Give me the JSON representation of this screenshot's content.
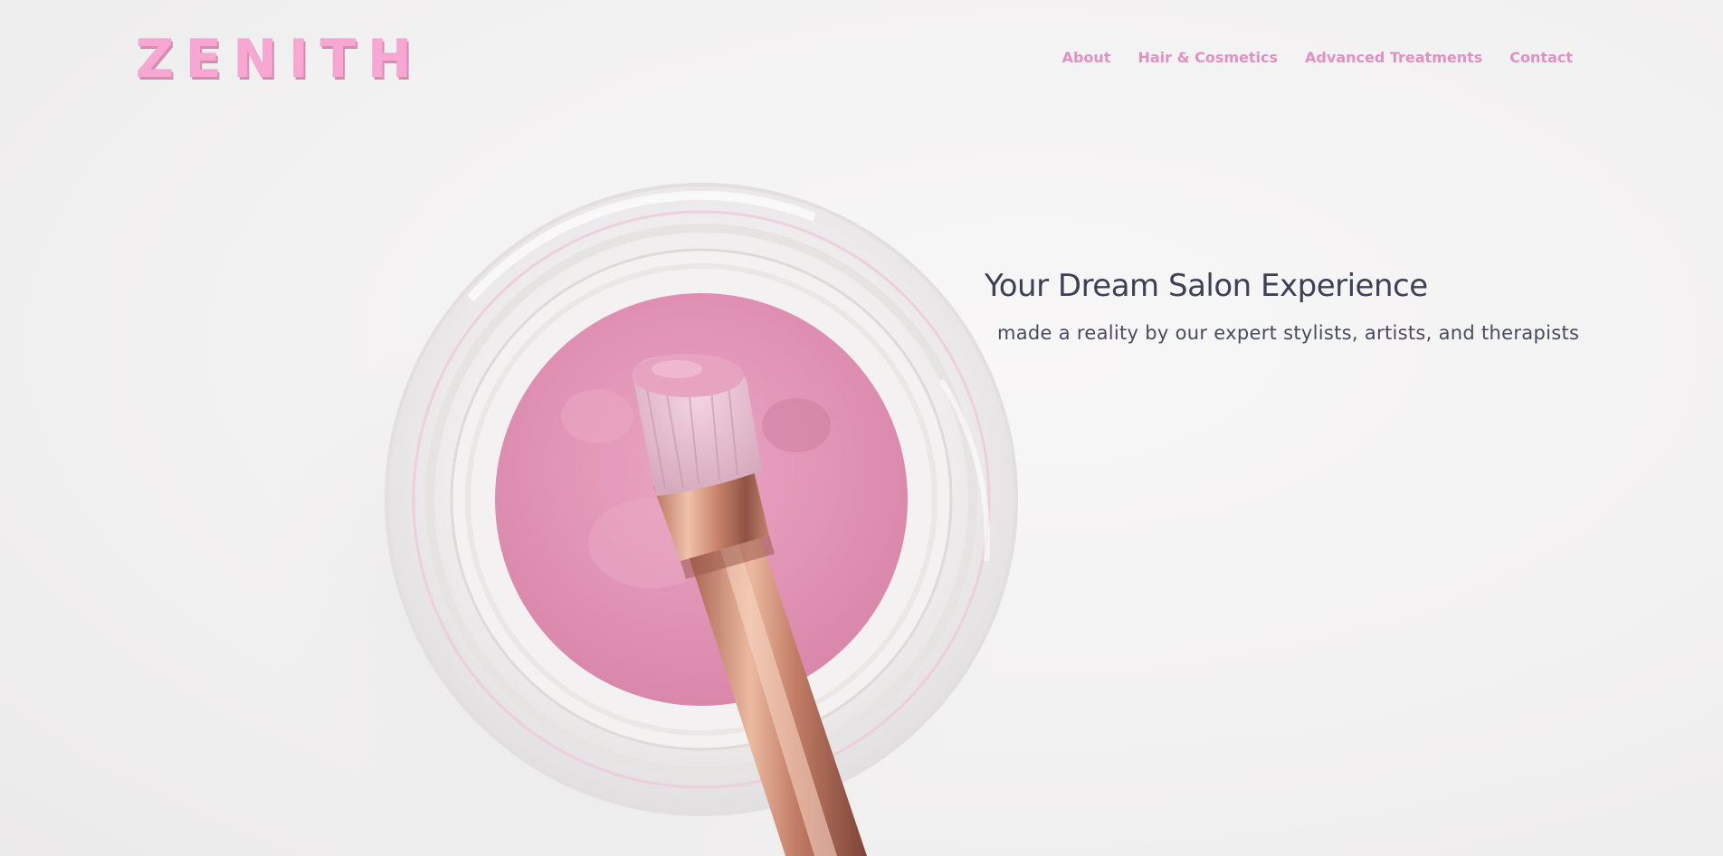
{
  "header": {
    "logo_text": "ZENITH",
    "nav": [
      {
        "label": "About"
      },
      {
        "label": "Hair & Cosmetics"
      },
      {
        "label": "Advanced Treatments"
      },
      {
        "label": "Contact"
      }
    ]
  },
  "hero": {
    "title": "Your Dream Salon Experience",
    "subtitle": "made a reality by our expert stylists, artists, and therapists",
    "image_subject": "pink-powder-jar-with-brush"
  },
  "colors": {
    "brand_pink": "#f8a6d2",
    "nav_pink": "#e290c2",
    "text_dark": "#3f3f56",
    "background": "#f4f3f3"
  }
}
